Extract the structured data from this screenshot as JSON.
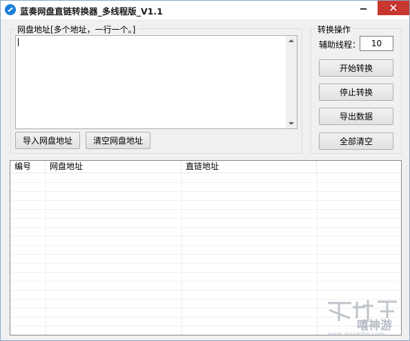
{
  "window": {
    "title": "蓝奏网盘直链转换器_多线程版_V1.1",
    "close_glyph": "✕"
  },
  "input_group": {
    "legend": "网盘地址[多个地址，一行一个。]",
    "textarea_value": "",
    "import_button": "导入网盘地址",
    "clear_button": "清空网盘地址"
  },
  "convert_group": {
    "legend": "转换操作",
    "threads_label": "辅助线程：",
    "threads_value": "10",
    "start_button": "开始转换",
    "stop_button": "停止转换",
    "export_button": "导出数据",
    "clear_all_button": "全部清空"
  },
  "results_table": {
    "columns": [
      "编号",
      "网盘地址",
      "直链地址",
      ""
    ],
    "rows": []
  },
  "watermark": {
    "subtitle": "嘻神游",
    "url": "www.xiazaiba.com"
  },
  "colors": {
    "close_button": "#c7372f",
    "app_icon": "#1c7fd8"
  },
  "icons": {
    "app": "app-icon",
    "minimize": "minimize-icon",
    "maximize": "maximize-icon",
    "close": "close-icon"
  }
}
